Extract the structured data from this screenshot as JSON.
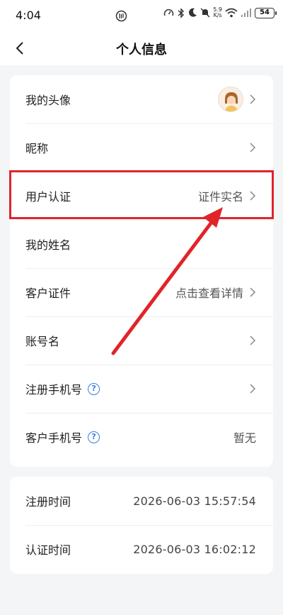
{
  "status_bar": {
    "time": "4:04",
    "network_speed_top": "5.9",
    "network_speed_bottom": "K/s",
    "battery": "54",
    "icons": [
      "app-notification-icon",
      "speedometer-icon",
      "bluetooth-icon",
      "moon-icon",
      "mute-icon",
      "wifi-icon",
      "signal-icon",
      "battery-icon"
    ]
  },
  "header": {
    "title": "个人信息",
    "back_icon": "chevron-left-icon"
  },
  "rows": [
    {
      "label": "我的头像",
      "value": "",
      "has_avatar": true,
      "has_chevron": true,
      "has_help": false
    },
    {
      "label": "昵称",
      "value": "",
      "has_avatar": false,
      "has_chevron": true,
      "has_help": false
    },
    {
      "label": "用户认证",
      "value": "证件实名",
      "has_avatar": false,
      "has_chevron": true,
      "has_help": false
    },
    {
      "label": "我的姓名",
      "value": "",
      "has_avatar": false,
      "has_chevron": false,
      "has_help": false
    },
    {
      "label": "客户证件",
      "value": "点击查看详情",
      "has_avatar": false,
      "has_chevron": true,
      "has_help": false
    },
    {
      "label": "账号名",
      "value": "",
      "has_avatar": false,
      "has_chevron": true,
      "has_help": false
    },
    {
      "label": "注册手机号",
      "value": "",
      "has_avatar": false,
      "has_chevron": true,
      "has_help": true
    },
    {
      "label": "客户手机号",
      "value": "暂无",
      "has_avatar": false,
      "has_chevron": false,
      "has_help": true
    }
  ],
  "times": [
    {
      "label": "注册时间",
      "value": "2026-06-03 15:57:54"
    },
    {
      "label": "认证时间",
      "value": "2026-06-03 16:02:12"
    }
  ],
  "annotation": {
    "highlight_color": "#e0242a",
    "arrow_color": "#e0242a",
    "target": "用户认证"
  },
  "colors": {
    "background": "#f4f5f7",
    "card": "#ffffff",
    "help_icon": "#3f7be8"
  }
}
